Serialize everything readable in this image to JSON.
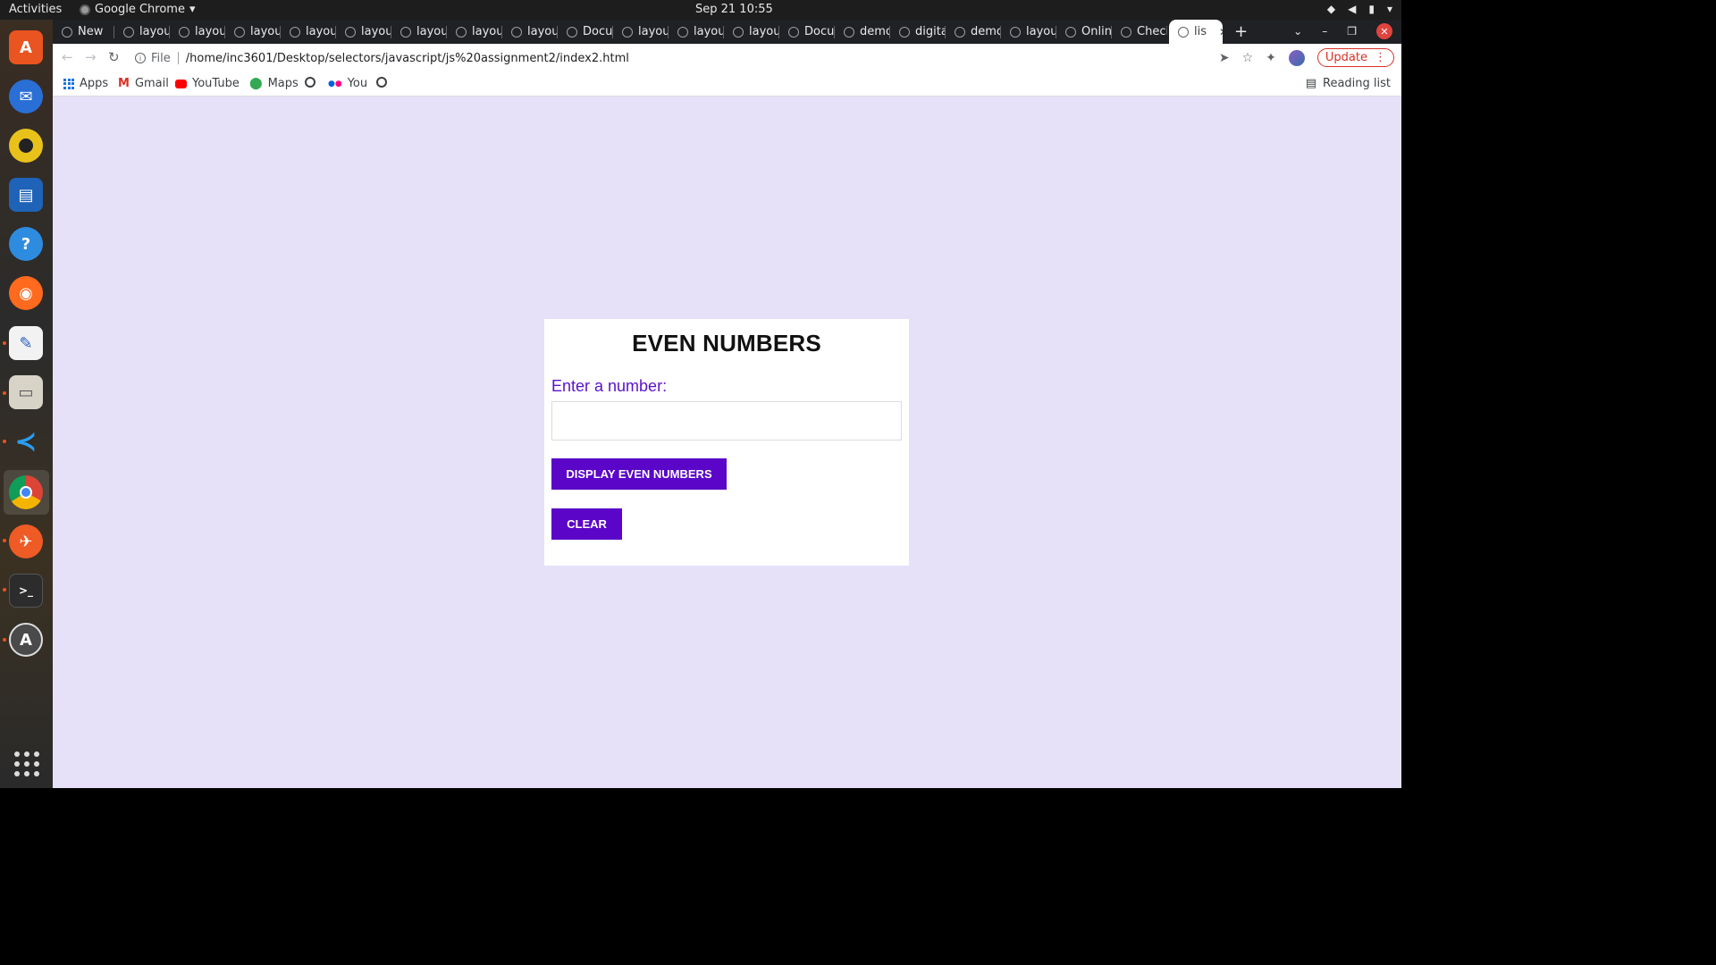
{
  "topbar": {
    "activities": "Activities",
    "app_name": "Google Chrome",
    "app_menu_icon": "chevron-down-icon",
    "clock": "Sep 21  10:55",
    "tray_icons": [
      "wifi-icon",
      "volume-icon",
      "battery-icon",
      "power-menu-icon"
    ]
  },
  "dock": {
    "apps": [
      "ubuntu-software",
      "thunderbird",
      "rhythmbox",
      "libreoffice-writer",
      "help",
      "firefox",
      "text-editor",
      "files",
      "vscode",
      "chrome",
      "postman",
      "terminal",
      "software-updater"
    ],
    "show_apps": "show-applications-icon"
  },
  "tabs": [
    {
      "label": "New"
    },
    {
      "label": "layou"
    },
    {
      "label": "layou"
    },
    {
      "label": "layou"
    },
    {
      "label": "layou"
    },
    {
      "label": "layou"
    },
    {
      "label": "layou"
    },
    {
      "label": "layou"
    },
    {
      "label": "layou"
    },
    {
      "label": "Docu"
    },
    {
      "label": "layou"
    },
    {
      "label": "layou"
    },
    {
      "label": "layou"
    },
    {
      "label": "Docu"
    },
    {
      "label": "demo"
    },
    {
      "label": "digita"
    },
    {
      "label": "demo"
    },
    {
      "label": "layou"
    },
    {
      "label": "Onlin"
    },
    {
      "label": "Checi"
    },
    {
      "label": "lis",
      "active": true
    }
  ],
  "toolbar": {
    "file_label": "File",
    "url": "/home/inc3601/Desktop/selectors/javascript/js%20assignment2/index2.html",
    "update_label": "Update"
  },
  "bookmarks": {
    "apps": "Apps",
    "gmail": "Gmail",
    "youtube": "YouTube",
    "maps": "Maps",
    "you": "You",
    "reading_list": "Reading list"
  },
  "page": {
    "title": "EVEN NUMBERS",
    "label": "Enter a number:",
    "input_value": "",
    "display_button": "DISPLAY EVEN NUMBERS",
    "clear_button": "CLEAR"
  },
  "colors": {
    "page_bg": "#e6e0f8",
    "accent": "#5a05c8",
    "label": "#5a12c9"
  }
}
